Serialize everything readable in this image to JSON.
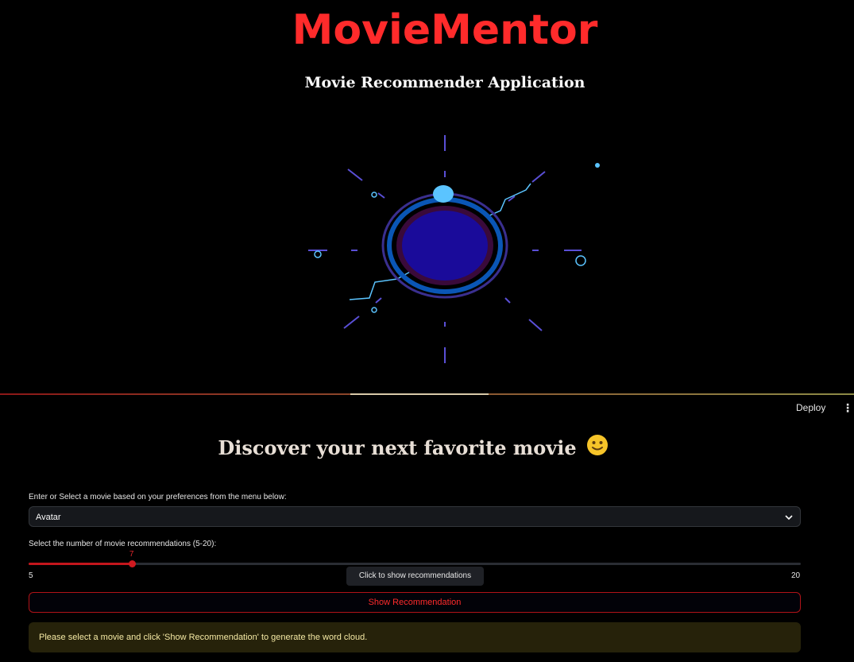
{
  "brand": {
    "title": "MovieMentor",
    "color": "#ff2b2b"
  },
  "subtitle": "Movie Recommender Application",
  "header": {
    "deploy_label": "Deploy",
    "menu_icon": "kebab-menu-icon"
  },
  "main": {
    "heading": "Discover your next favorite movie",
    "heading_emoji": "slightly-smiling-face-icon",
    "movie_select": {
      "label": "Enter or Select a movie based on your preferences from the menu below:",
      "value": "Avatar"
    },
    "slider": {
      "label": "Select the number of movie recommendations (5-20):",
      "value": 7,
      "value_label": "7",
      "min": 5,
      "max": 20,
      "min_label": "5",
      "max_label": "20",
      "tooltip": "Click to show recommendations"
    },
    "show_button": "Show Recommendation",
    "alert": "Please select a movie and click 'Show Recommendation' to generate the word cloud."
  },
  "colors": {
    "background": "#000000",
    "accent": "#ff2b2b",
    "hero_core": "#1a0b9a",
    "hero_ring": "#0a56b5",
    "hero_light": "#5bc4ff"
  }
}
